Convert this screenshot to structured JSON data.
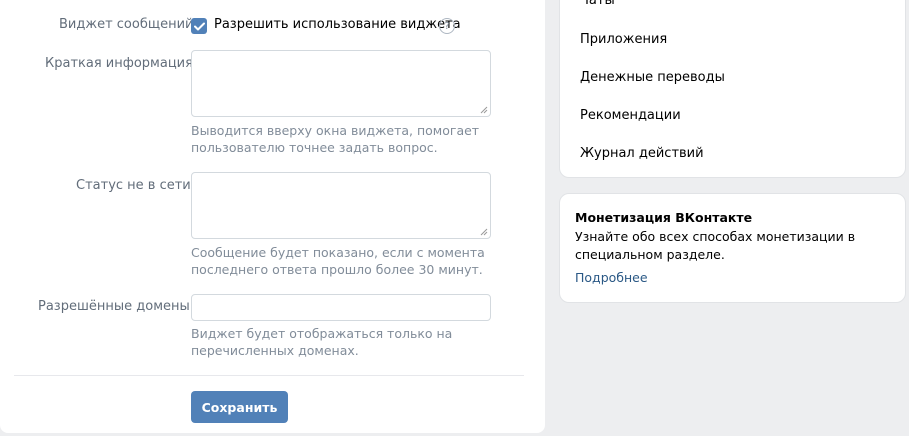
{
  "form": {
    "widget_label": "Виджет сообщений:",
    "widget_checkbox_label": "Разрешить использование виджета",
    "widget_checked": true,
    "help_icon": "?",
    "short_info_label": "Краткая информация:",
    "short_info_value": "",
    "short_info_hint": "Выводится вверху окна виджета, помогает пользователю точнее задать вопрос.",
    "offline_label": "Статус не в сети:",
    "offline_value": "",
    "offline_hint": "Сообщение будет показано, если с момента последнего ответа прошло более 30 минут.",
    "domains_label": "Разрешённые домены:",
    "domains_value": "",
    "domains_hint": "Виджет будет отображаться только на перечисленных доменах.",
    "save_label": "Сохранить"
  },
  "menu": {
    "items": [
      "Чаты",
      "Приложения",
      "Денежные переводы",
      "Рекомендации",
      "Журнал действий"
    ]
  },
  "promo": {
    "title": "Монетизация ВКонтакте",
    "text": "Узнайте обо всех способах монетизации в специальном разделе.",
    "link": "Подробнее"
  },
  "colors": {
    "accent": "#5181b8",
    "link": "#2a5885",
    "label": "#626d7a",
    "hint": "#818c99"
  }
}
